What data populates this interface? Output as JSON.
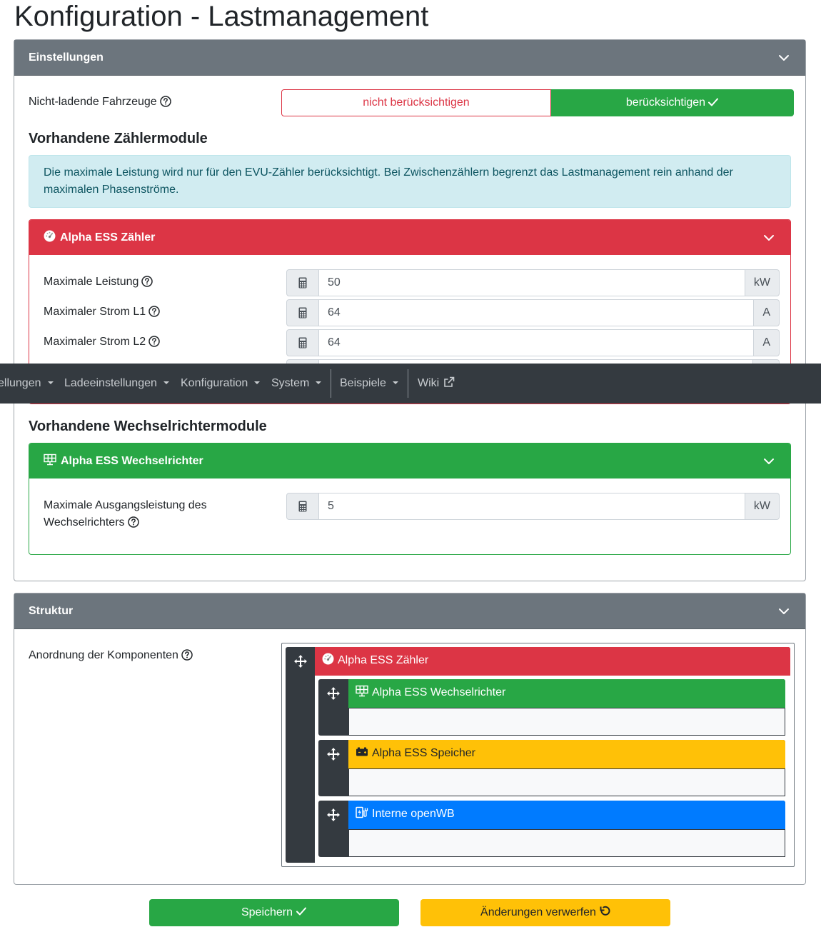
{
  "page": {
    "title": "Konfiguration - Lastmanagement"
  },
  "settings": {
    "header": "Einstellungen",
    "nonCharging": {
      "label": "Nicht-ladende Fahrzeuge",
      "options": [
        "nicht berücksichtigen",
        "berücksichtigen"
      ],
      "selected": "berücksichtigen"
    },
    "counterSection": {
      "title": "Vorhandene Zählermodule",
      "info": "Die maximale Leistung wird nur für den EVU-Zähler berücksichtigt. Bei Zwischenzählern begrenzt das Lastmanagement rein anhand der maximalen Phasenströme.",
      "counter": {
        "title": "Alpha ESS Zähler",
        "fields": [
          {
            "label": "Maximale Leistung",
            "value": "50",
            "unit": "kW"
          },
          {
            "label": "Maximaler Strom L1",
            "value": "64",
            "unit": "A"
          },
          {
            "label": "Maximaler Strom L2",
            "value": "64",
            "unit": "A"
          }
        ]
      }
    },
    "inverterSection": {
      "title": "Vorhandene Wechselrichtermodule",
      "inverter": {
        "title": "Alpha ESS Wechselrichter",
        "field": {
          "label_line1": "Maximale Ausgangsleistung des",
          "label_line2": "Wechselrichters",
          "value": "5",
          "unit": "kW"
        }
      }
    }
  },
  "navbar": {
    "items": [
      "ellungen",
      "Ladeeinstellungen",
      "Konfiguration",
      "System",
      "Beispiele",
      "Wiki"
    ]
  },
  "structure": {
    "header": "Struktur",
    "label": "Anordnung der Komponenten",
    "root": "Alpha ESS Zähler",
    "children": [
      "Alpha ESS Wechselrichter",
      "Alpha ESS Speicher",
      "Interne openWB"
    ]
  },
  "actions": {
    "save": "Speichern",
    "discard": "Änderungen verwerfen"
  },
  "colors": {
    "danger": "#dc3545",
    "success": "#28a745",
    "warning": "#ffc107",
    "primary": "#007bff",
    "secondary": "#6c757d",
    "dark": "#343a40"
  },
  "icons": {
    "chevron": "chevron-down-icon",
    "help": "question-circle-icon",
    "gauge": "gauge-icon",
    "solar": "solar-panel-icon",
    "calculator": "calculator-icon",
    "move": "move-arrows-icon",
    "battery": "car-battery-icon",
    "charger": "charging-station-icon",
    "external": "external-link-icon",
    "check": "check-icon",
    "undo": "undo-icon"
  }
}
